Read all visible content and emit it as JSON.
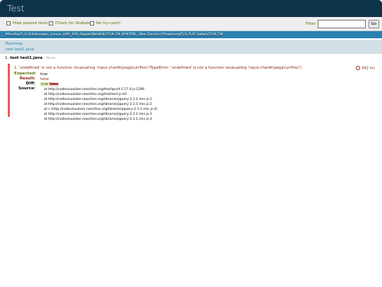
{
  "header": {
    "title": "Test"
  },
  "toolbar": {
    "hide_passed": "Hide passed tests",
    "check_globals": "Check for Globals",
    "no_try_catch": "No try-catch",
    "filter_label": "Filter:",
    "filter_value": "",
    "go_label": "Go"
  },
  "user_agent": "Mozilla/5.0 (Unknown; Linux x86_64) AppleWebKit/534.34 (KHTML, like Gecko) PhantomJS/1.9.8 Safari/534.34",
  "status": {
    "line1": "Running:",
    "line2": "test test1.java"
  },
  "test": {
    "number": "1.",
    "name": "test test1.java",
    "rerun": "Rerun",
    "failure": {
      "message": "1. 'undefined' is not a function (evaluating 'input.charAt(peg$currPos)')TypeError: 'undefined' is not a function (evaluating 'input.charAt(peg$currPos)')",
      "time": "942 ms",
      "expected_label": "Expected:",
      "expected_value": "true",
      "result_label": "Result:",
      "result_value": "false",
      "diff_label": "Diff:",
      "diff_ins": "true",
      "diff_del": "false",
      "source_label": "Source:",
      "source_lines": [
        "at http://codevisualizer.neocities.org/test/qunit-1.17.0.js:1296",
        "at http://codevisualizer.neocities.org/test/test.js:43",
        "at http://codevisualizer.neocities.org/libraries/jquery-2.1.1.min.js:2",
        "at http://codevisualizer.neocities.org/libraries/jquery-2.1.1.min.js:2",
        "at c (http://codevisualizer.neocities.org/libraries/jquery-2.1.1.min.js:4)",
        "at http://codevisualizer.neocities.org/libraries/jquery-2.1.1.min.js:2",
        "at http://codevisualizer.neocities.org/libraries/jquery-2.1.1.min.js:4"
      ]
    }
  },
  "colors": {
    "header_bg": "#0d3349",
    "user_agent_bg": "#2b81af",
    "fail_border": "#ee5757"
  }
}
